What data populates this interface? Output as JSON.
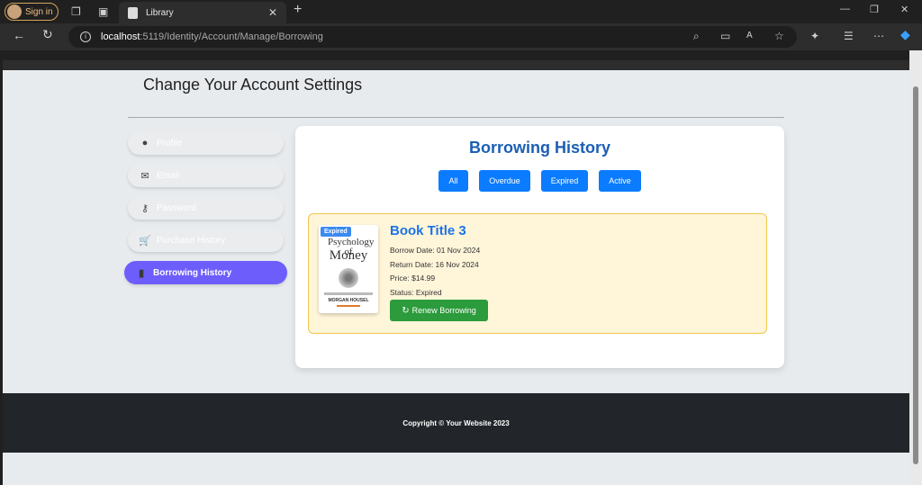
{
  "browser": {
    "signin_label": "Sign in",
    "tab_title": "Library",
    "url_host": "localhost",
    "url_rest": ":5119/Identity/Account/Manage/Borrowing"
  },
  "page": {
    "heading": "Change Your Account Settings"
  },
  "sidebar": {
    "items": [
      {
        "label": "Profile",
        "icon": "user-circle-icon"
      },
      {
        "label": "Email",
        "icon": "envelope-icon"
      },
      {
        "label": "Password",
        "icon": "key-icon"
      },
      {
        "label": "Purchase History",
        "icon": "cart-icon"
      },
      {
        "label": "Borrowing History",
        "icon": "book-icon",
        "active": true
      }
    ]
  },
  "borrowing": {
    "title": "Borrowing History",
    "filters": [
      "All",
      "Overdue",
      "Expired",
      "Active"
    ],
    "book": {
      "badge": "Expired",
      "cover_title_top": "Psychology of",
      "cover_title_main": "Money",
      "cover_author": "MORGAN HOUSEL",
      "title": "Book Title 3",
      "borrow_date": "Borrow Date: 01 Nov 2024",
      "return_date": "Return Date: 16 Nov 2024",
      "price": "Price: $14.99",
      "status": "Status: Expired",
      "renew_label": "Renew Borrowing"
    }
  },
  "footer": {
    "text": "Copyright © Your Website 2023"
  },
  "colors": {
    "accent": "#0b7bff",
    "sidebar_active": "#6d5efc",
    "renew_green": "#2b9b3c",
    "book_card_bg": "#fff5d9",
    "title_blue": "#1a5fb4"
  }
}
